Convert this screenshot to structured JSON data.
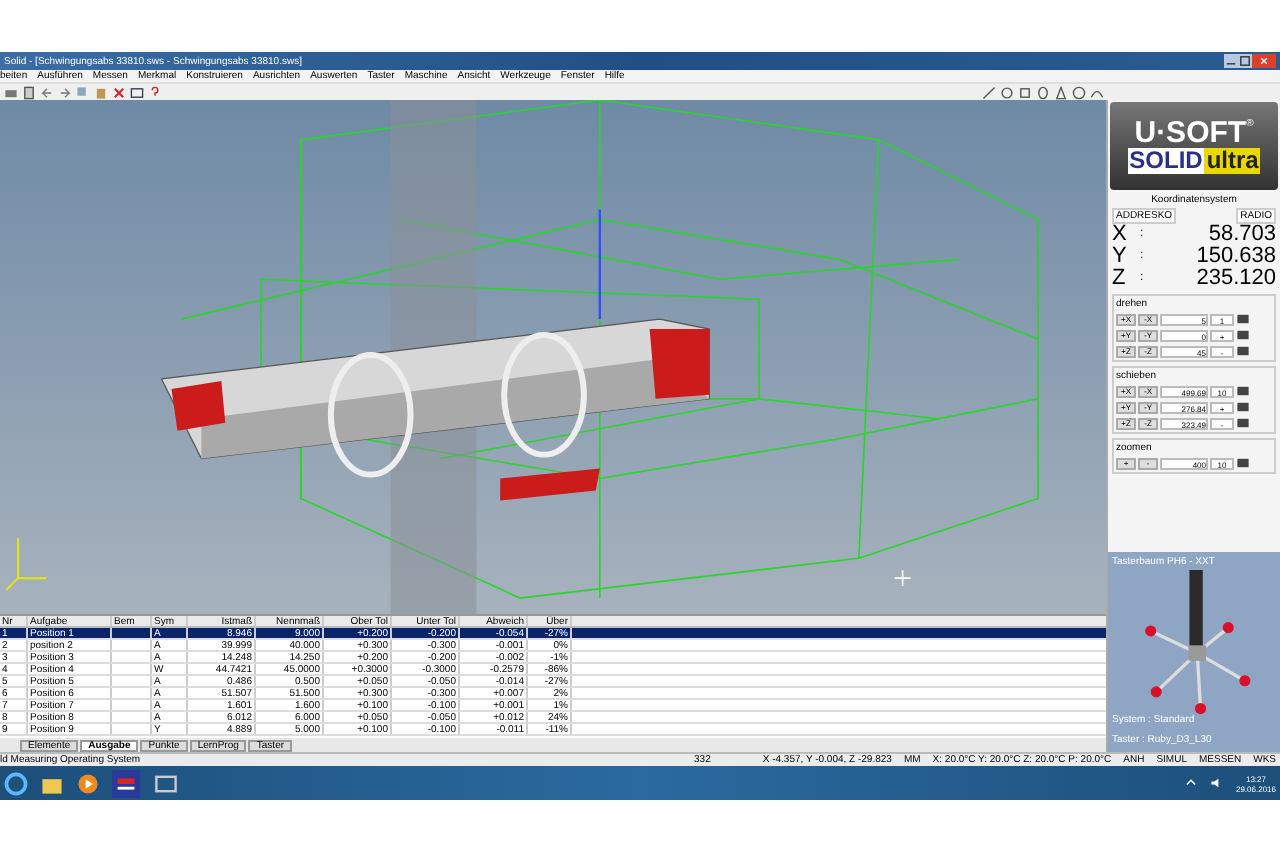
{
  "window": {
    "title": "Solid - [Schwingungsabs 33810.sws - Schwingungsabs 33810.sws]"
  },
  "menu": [
    "beiten",
    "Ausführen",
    "Messen",
    "Merkmal",
    "Konstruieren",
    "Ausrichten",
    "Auswerten",
    "Taster",
    "Maschine",
    "Ansicht",
    "Werkzeuge",
    "Fenster",
    "Hilfe"
  ],
  "side_panel": {
    "logo": {
      "top": "U·SOFT",
      "mark": "®",
      "bottom_left": "SOLID",
      "bottom_right": "ultra"
    },
    "coord_title": "Koordinatensystem",
    "coord_fields": [
      "ADDRESKO",
      "RADIO"
    ],
    "readouts": [
      {
        "axis": "X",
        "sep": ":",
        "value": "58.703"
      },
      {
        "axis": "Y",
        "sep": ":",
        "value": "150.638"
      },
      {
        "axis": "Z",
        "sep": ":",
        "value": "235.120"
      }
    ],
    "groups": [
      {
        "title": "drehen",
        "rows": [
          {
            "plus": "+X",
            "minus": "-X",
            "value": "5",
            "step": "1"
          },
          {
            "plus": "+Y",
            "minus": "-Y",
            "value": "0",
            "step": "+"
          },
          {
            "plus": "+Z",
            "minus": "-Z",
            "value": "45",
            "step": "-"
          }
        ]
      },
      {
        "title": "schieben",
        "rows": [
          {
            "plus": "+X",
            "minus": "-X",
            "value": "499.69",
            "step": "10"
          },
          {
            "plus": "+Y",
            "minus": "-Y",
            "value": "276.84",
            "step": "+"
          },
          {
            "plus": "+Z",
            "minus": "-Z",
            "value": "323.49",
            "step": "-"
          }
        ]
      },
      {
        "title": "zoomen",
        "rows": [
          {
            "plus": "+",
            "minus": "-",
            "value": "400",
            "step": "10"
          }
        ]
      }
    ],
    "probe": {
      "title": "Tasterbaum PH6 - XXT",
      "system": "System : Standard",
      "probe": "Taster : Ruby_D3_L30"
    }
  },
  "table": {
    "columns": [
      "Nr",
      "Aufgabe",
      "Bem",
      "Sym",
      "Istmaß",
      "Nennmaß",
      "Ober Tol",
      "Unter Tol",
      "Abweich",
      "Über"
    ],
    "rows": [
      {
        "selected": true,
        "cells": [
          "1",
          "Position 1",
          "",
          "A",
          "8.946",
          "9.000",
          "+0.200",
          "-0.200",
          "-0.054",
          "-27%"
        ]
      },
      {
        "selected": false,
        "cells": [
          "2",
          "position 2",
          "",
          "A",
          "39.999",
          "40.000",
          "+0.300",
          "-0.300",
          "-0.001",
          "0%"
        ]
      },
      {
        "selected": false,
        "cells": [
          "3",
          "Position 3",
          "",
          "A",
          "14.248",
          "14.250",
          "+0.200",
          "-0.200",
          "-0.002",
          "-1%"
        ]
      },
      {
        "selected": false,
        "cells": [
          "4",
          "Position 4",
          "",
          "W",
          "44.7421",
          "45.0000",
          "+0.3000",
          "-0.3000",
          "-0.2579",
          "-86%"
        ]
      },
      {
        "selected": false,
        "cells": [
          "5",
          "Position 5",
          "",
          "A",
          "0.486",
          "0.500",
          "+0.050",
          "-0.050",
          "-0.014",
          "-27%"
        ]
      },
      {
        "selected": false,
        "cells": [
          "6",
          "Position 6",
          "",
          "A",
          "51.507",
          "51.500",
          "+0.300",
          "-0.300",
          "+0.007",
          "2%"
        ]
      },
      {
        "selected": false,
        "cells": [
          "7",
          "Position 7",
          "",
          "A",
          "1.601",
          "1.600",
          "+0.100",
          "-0.100",
          "+0.001",
          "1%"
        ]
      },
      {
        "selected": false,
        "cells": [
          "8",
          "Position 8",
          "",
          "A",
          "6.012",
          "6.000",
          "+0.050",
          "-0.050",
          "+0.012",
          "24%"
        ]
      },
      {
        "selected": false,
        "cells": [
          "9",
          "Position 9",
          "",
          "Y",
          "4.889",
          "5.000",
          "+0.100",
          "-0.100",
          "-0.011",
          "-11%"
        ]
      }
    ]
  },
  "tabs": [
    {
      "label": "Elemente",
      "selected": false
    },
    {
      "label": "Ausgabe",
      "selected": true
    },
    {
      "label": "Punkte",
      "selected": false
    },
    {
      "label": "LernProg",
      "selected": false
    },
    {
      "label": "Taster",
      "selected": false
    }
  ],
  "status_bar": {
    "message": "ld Measuring Operating System",
    "count": "332",
    "position": "X -4.357, Y -0.004, Z -29.823",
    "unit": "MM",
    "temperatures": "X: 20.0°C Y: 20.0°C Z: 20.0°C P: 20.0°C",
    "flags": [
      "ANH",
      "SIMUL",
      "MESSEN",
      "WKS"
    ]
  },
  "taskbar": {
    "time": "13:27",
    "date": "29.06.2016"
  }
}
